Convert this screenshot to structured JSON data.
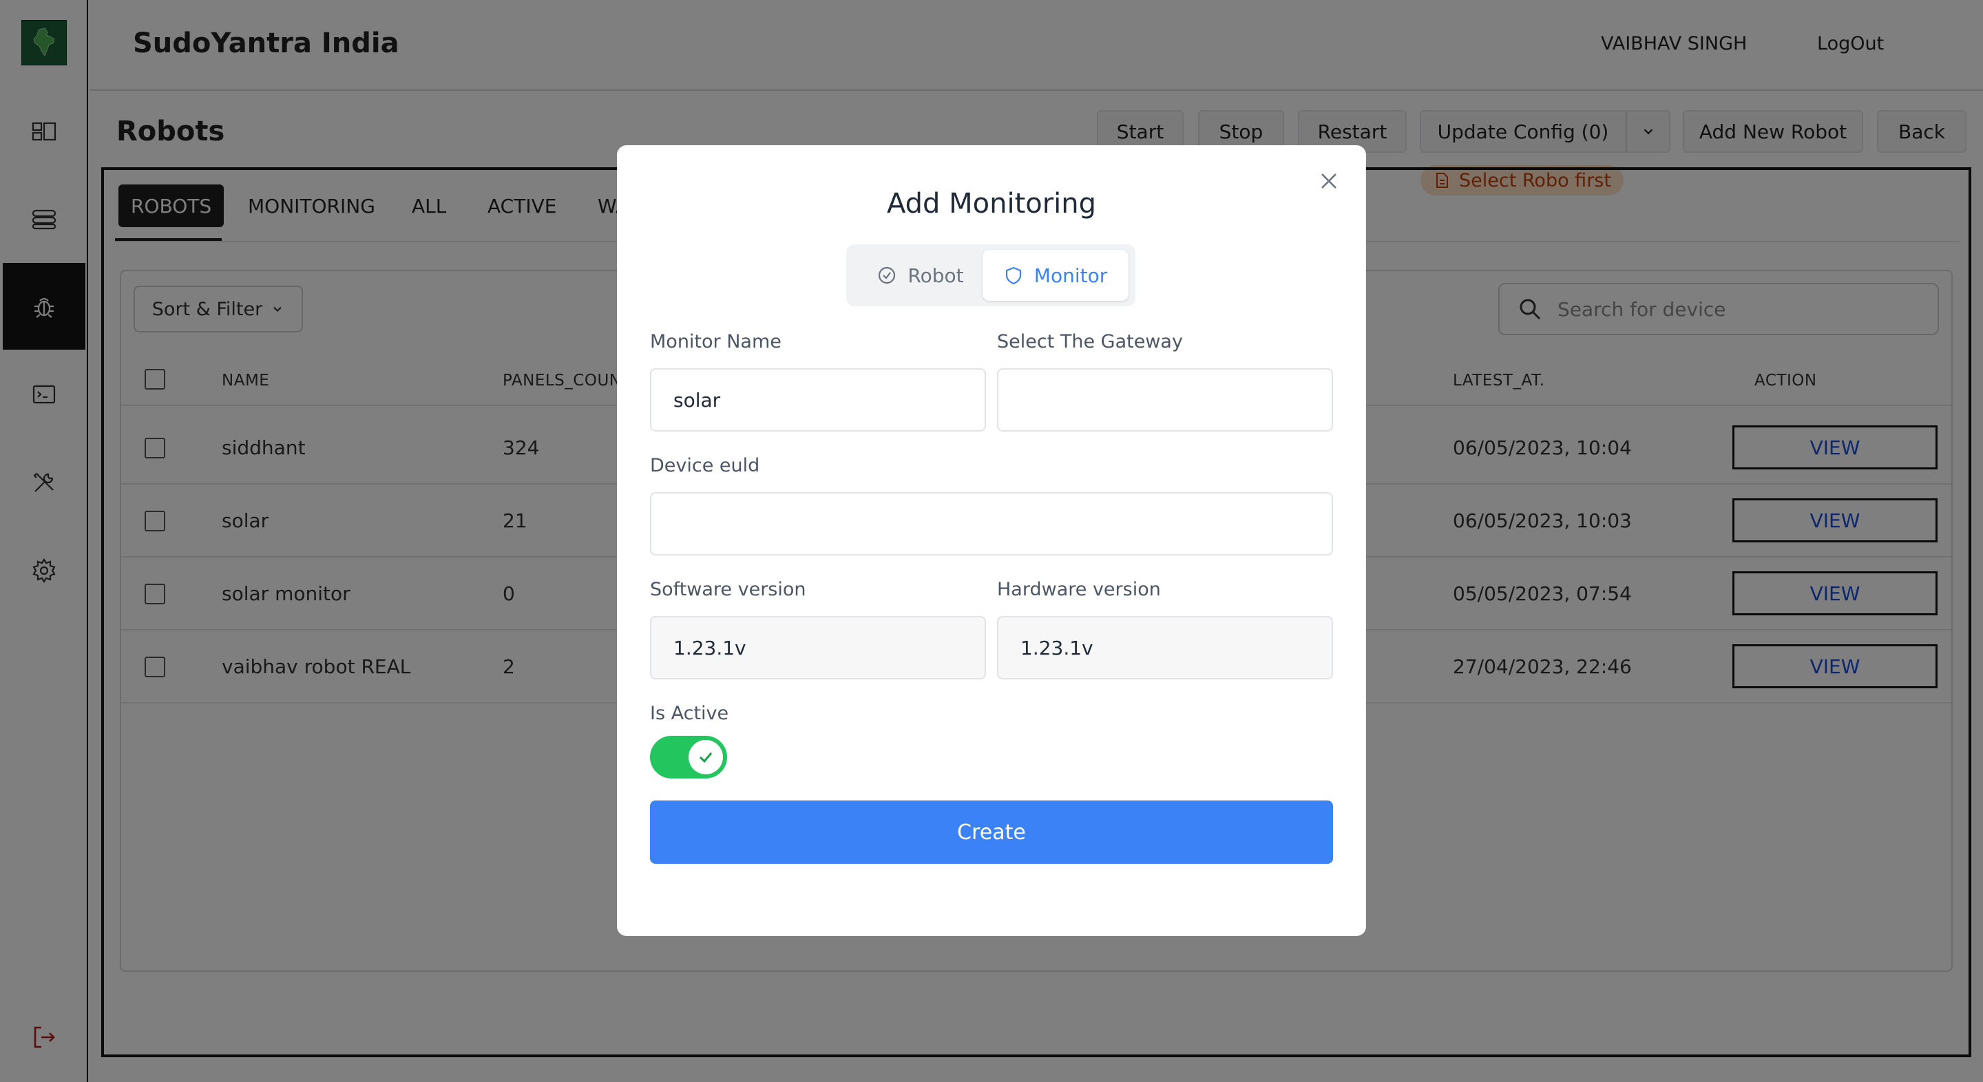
{
  "app": {
    "brand": "SudoYantra India"
  },
  "header": {
    "user": "VAIBHAV SINGH",
    "logout": "LogOut"
  },
  "sidebar": {
    "items": [
      {
        "name": "dashboard",
        "icon": "dashboard-icon"
      },
      {
        "name": "storage",
        "icon": "database-icon"
      },
      {
        "name": "robots",
        "icon": "bug-icon",
        "active": true
      },
      {
        "name": "terminal",
        "icon": "terminal-icon"
      },
      {
        "name": "tools",
        "icon": "tools-icon"
      },
      {
        "name": "settings",
        "icon": "gear-icon"
      }
    ],
    "logout_icon": "sign-out-icon"
  },
  "page": {
    "title": "Robots",
    "toolbar": {
      "start": "Start",
      "stop": "Stop",
      "restart": "Restart",
      "update_config": "Update Config (0)",
      "add_new_robot": "Add New Robot",
      "back": "Back"
    },
    "hint": "Select Robo first",
    "tabs": [
      "ROBOTS",
      "MONITORING",
      "ALL",
      "ACTIVE",
      "WA"
    ],
    "sort_filter": "Sort & Filter",
    "search_placeholder": "Search for device",
    "table": {
      "columns": [
        "NAME",
        "PANELS_COUN",
        "LATEST_AT.",
        "ACTION"
      ],
      "rows": [
        {
          "name": "siddhant",
          "panels": "324",
          "latest": "06/05/2023, 10:04",
          "action": "VIEW"
        },
        {
          "name": "solar",
          "panels": "21",
          "latest": "06/05/2023, 10:03",
          "action": "VIEW"
        },
        {
          "name": "solar monitor",
          "panels": "0",
          "latest": "05/05/2023, 07:54",
          "action": "VIEW"
        },
        {
          "name": "vaibhav robot REAL",
          "panels": "2",
          "latest": "27/04/2023, 22:46",
          "action": "VIEW"
        }
      ]
    }
  },
  "modal": {
    "title": "Add Monitoring",
    "segments": [
      {
        "label": "Robot",
        "icon": "check-circle-icon"
      },
      {
        "label": "Monitor",
        "icon": "shield-icon",
        "active": true
      }
    ],
    "fields": {
      "monitor_name": {
        "label": "Monitor Name",
        "value": "solar"
      },
      "gateway": {
        "label": "Select The Gateway",
        "value": ""
      },
      "device_euid": {
        "label": "Device euld",
        "value": ""
      },
      "software_version": {
        "label": "Software version",
        "value": "1.23.1v"
      },
      "hardware_version": {
        "label": "Hardware version",
        "value": "1.23.1v"
      },
      "is_active": {
        "label": "Is Active",
        "value": true
      }
    },
    "create": "Create"
  },
  "colors": {
    "accent": "#3b82f6",
    "toggle_on": "#22c55e",
    "hint_bg": "#fde2c6",
    "hint_text": "#c2410c",
    "sidebar_active": "#151515",
    "view_link": "#1d4ed8"
  }
}
